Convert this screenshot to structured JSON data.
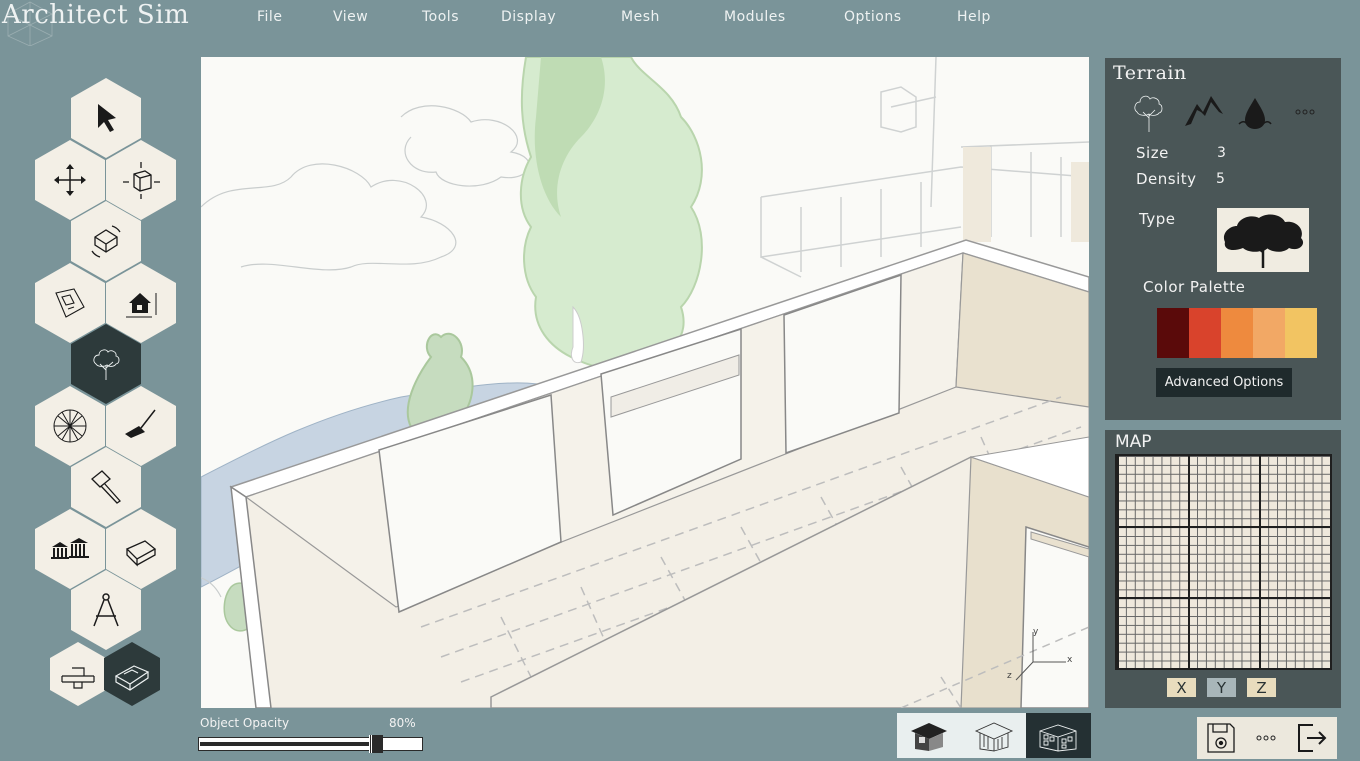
{
  "app": {
    "title": "Architect Sim"
  },
  "menu": {
    "items": [
      "File",
      "View",
      "Tools",
      "Display",
      "Mesh",
      "Modules",
      "Options",
      "Help"
    ]
  },
  "toolbar": {
    "tools": [
      {
        "name": "select",
        "icon": "cursor-arrow-icon",
        "active": false
      },
      {
        "name": "move",
        "icon": "move-arrows-icon",
        "active": false
      },
      {
        "name": "scale",
        "icon": "scale-cube-icon",
        "active": false
      },
      {
        "name": "rotate",
        "icon": "rotate-cube-icon",
        "active": false
      },
      {
        "name": "floor-plan",
        "icon": "floor-plan-icon",
        "active": false
      },
      {
        "name": "house-dimensions",
        "icon": "house-dimensions-icon",
        "active": false
      },
      {
        "name": "terrain",
        "icon": "tree-icon",
        "active": true
      },
      {
        "name": "mesh",
        "icon": "geodesic-sphere-icon",
        "active": false
      },
      {
        "name": "paint",
        "icon": "paint-brush-icon",
        "active": false
      },
      {
        "name": "hammer",
        "icon": "hammer-icon",
        "active": false
      },
      {
        "name": "buildings",
        "icon": "classical-buildings-icon",
        "active": false
      },
      {
        "name": "eraser",
        "icon": "eraser-icon",
        "active": false
      },
      {
        "name": "compass",
        "icon": "drafting-compass-icon",
        "active": false
      },
      {
        "name": "section",
        "icon": "section-cut-icon",
        "active": false
      },
      {
        "name": "model-tool",
        "icon": "model-tool-icon",
        "active": true
      }
    ]
  },
  "opacity": {
    "label": "Object Opacity",
    "value_text": "80%",
    "value": 0.8
  },
  "view_modes": [
    {
      "name": "shaded",
      "icon": "shaded-house-icon",
      "active": false
    },
    {
      "name": "wireframe",
      "icon": "wireframe-house-icon",
      "active": false
    },
    {
      "name": "facade",
      "icon": "facade-icon",
      "active": true
    }
  ],
  "terrain": {
    "title": "Terrain",
    "categories": [
      {
        "name": "tree",
        "icon": "tree-icon"
      },
      {
        "name": "mountain",
        "icon": "mountain-icon"
      },
      {
        "name": "water",
        "icon": "water-drop-icon"
      },
      {
        "name": "more",
        "icon": "more-dots-icon"
      }
    ],
    "size_label": "Size",
    "size_value": "3",
    "density_label": "Density",
    "density_value": "5",
    "type_label": "Type",
    "palette_label": "Color Palette",
    "palette": [
      "#5a0a0a",
      "#d9432c",
      "#ee8a3e",
      "#f2a865",
      "#f2c462"
    ],
    "advanced_label": "Advanced Options"
  },
  "map": {
    "title": "MAP",
    "axes": [
      "X",
      "Y",
      "Z"
    ],
    "axis_colors": [
      "#e8dcbd",
      "#a8b6b9",
      "#e8dcbd"
    ]
  },
  "viewport": {
    "axis_labels": {
      "x": "x",
      "y": "y",
      "z": "z"
    }
  }
}
